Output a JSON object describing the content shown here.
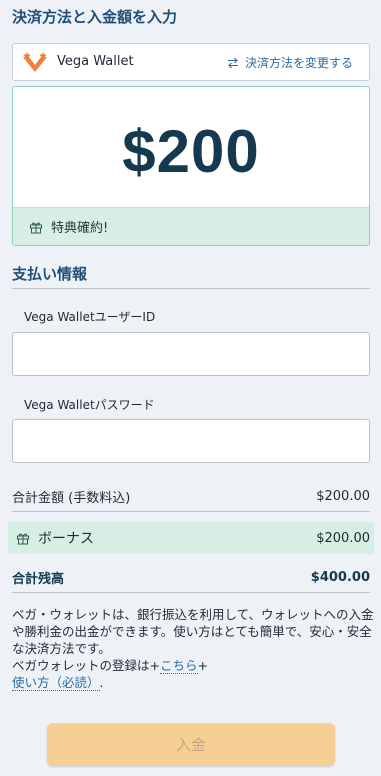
{
  "header": {
    "title": "決済方法と入金額を入力"
  },
  "method": {
    "name": "Vega Wallet",
    "change_label": "決済方法を変更する"
  },
  "amount": {
    "value": "$200",
    "perk_label": "特典確約!"
  },
  "payment_info": {
    "title": "支払い情報",
    "user_id_label": "Vega WalletユーザーID",
    "user_id_value": "",
    "password_label": "Vega Walletパスワード",
    "password_value": ""
  },
  "summary": {
    "total_label": "合計金額 (手数料込)",
    "total_value": "$200.00",
    "bonus_label": "ボーナス",
    "bonus_value": "$200.00",
    "balance_label": "合計残高",
    "balance_value": "$400.00"
  },
  "info": {
    "line1": "ベガ・ウォレットは、銀行振込を利用して、ウォレットへの入金や勝利金の出金ができます。使い方はとても簡単で、安心・安全な決済方法です。",
    "line2_prefix": "ベガウォレットの登録は+",
    "register_link": "こちら",
    "line2_suffix": "+",
    "usage_link": "使い方（必読）",
    "usage_suffix": "."
  },
  "deposit_button": {
    "label": "入金"
  },
  "colors": {
    "accent": "#1f4e79",
    "success_bg": "#d9efe5",
    "button": "#f6cf94"
  }
}
